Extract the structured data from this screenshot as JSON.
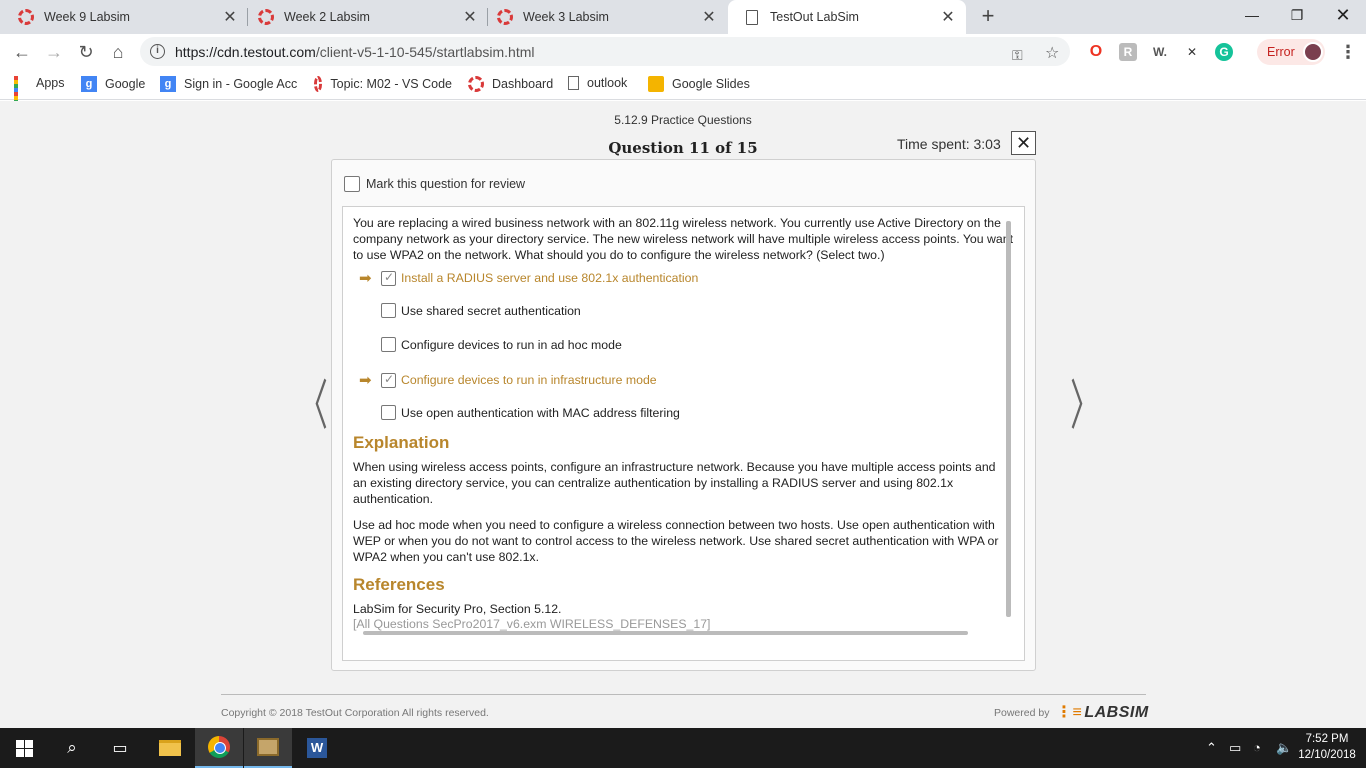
{
  "browser": {
    "tabs": [
      {
        "label": "Week 9 Labsim"
      },
      {
        "label": "Week 2 Labsim"
      },
      {
        "label": "Week 3 Labsim"
      },
      {
        "label": "TestOut LabSim"
      }
    ],
    "url_host": "https://cdn.testout.com",
    "url_path": "/client-v5-1-10-545/startlabsim.html",
    "error_label": "Error",
    "bookmarks": [
      {
        "label": "Apps"
      },
      {
        "label": "Google"
      },
      {
        "label": "Sign in - Google Acc"
      },
      {
        "label": "Topic: M02 - VS Code"
      },
      {
        "label": "Dashboard"
      },
      {
        "label": "outlook"
      },
      {
        "label": "Google Slides"
      }
    ]
  },
  "quiz": {
    "subtitle": "5.12.9 Practice Questions",
    "title": "Question 11 of 15",
    "time_spent": "Time spent: 3:03",
    "mark_review": "Mark this question for review",
    "question": "You are replacing a wired business network with an 802.11g wireless network. You currently use Active Directory on the company network as your directory service. The new wireless network will have multiple wireless access points. You want to use WPA2 on the network. What should you do to configure the wireless network? (Select two.)",
    "choices": [
      {
        "label": "Install a RADIUS server and use 802.1x authentication",
        "checked": true,
        "correct": true
      },
      {
        "label": "Use shared secret authentication",
        "checked": false,
        "correct": false
      },
      {
        "label": "Configure devices to run in ad hoc mode",
        "checked": false,
        "correct": false
      },
      {
        "label": "Configure devices to run in infrastructure mode",
        "checked": true,
        "correct": true
      },
      {
        "label": "Use open authentication with MAC address filtering",
        "checked": false,
        "correct": false
      }
    ],
    "explanation_heading": "Explanation",
    "explanation_p1": "When using wireless access points, configure an infrastructure network. Because you have multiple access points and an existing directory service, you can centralize authentication by installing a RADIUS server and using 802.1x authentication.",
    "explanation_p2": "Use ad hoc mode when you need to configure a wireless connection between two hosts. Use open authentication with WEP or when you do not want to control access to the wireless network. Use shared secret authentication with WPA or WPA2 when you can't use 802.1x.",
    "references_heading": "References",
    "reference": "LabSim for Security Pro, Section 5.12.",
    "reference_tag": "[All Questions SecPro2017_v6.exm WIRELESS_DEFENSES_17]"
  },
  "footer": {
    "copyright": "Copyright © 2018  TestOut Corporation All rights reserved.",
    "powered_by": "Powered by",
    "logo": "LABSIM"
  },
  "taskbar": {
    "time": "7:52 PM",
    "date": "12/10/2018"
  },
  "colors": {
    "accent": "#b8862c",
    "page_bg": "#f2f2f2",
    "taskbar": "#1b1b1b"
  }
}
